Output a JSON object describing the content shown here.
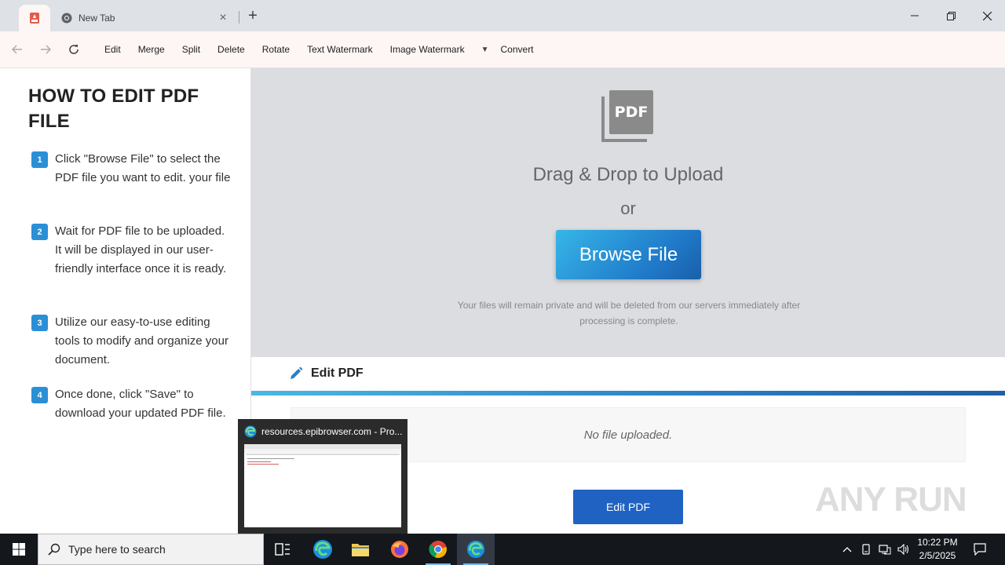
{
  "browser": {
    "active_tab_icon": "pdf-app-icon",
    "tabs": [
      {
        "title": "New Tab",
        "icon": "chrome-icon"
      }
    ],
    "new_tab_symbol": "+",
    "window_controls": {
      "minimize": "—",
      "maximize": "❐",
      "close": "✕"
    }
  },
  "toolbar": {
    "nav": {
      "back": "←",
      "forward": "→",
      "reload": "↻"
    },
    "items": [
      "Edit",
      "Merge",
      "Split",
      "Delete",
      "Rotate",
      "Text Watermark",
      "Image Watermark"
    ],
    "dropdown_caret": "▼",
    "convert_label": "Convert"
  },
  "guide": {
    "title": "HOW TO EDIT PDF FILE",
    "steps": [
      {
        "num": "1",
        "text": "Click \"Browse File\" to select the PDF file you want to edit. your file"
      },
      {
        "num": "2",
        "text": "Wait for PDF file to be uploaded. It will be displayed in our user-friendly interface once it is ready."
      },
      {
        "num": "3",
        "text": "Utilize our easy-to-use editing tools to modify and organize your document."
      },
      {
        "num": "4",
        "text": "Once done, click \"Save\" to download your updated PDF file."
      }
    ]
  },
  "upload": {
    "icon_label": "PDF",
    "drag_text": "Drag & Drop to Upload",
    "or_text": "or",
    "browse_label": "Browse File",
    "privacy_text": "Your files will remain private and will be deleted from our servers immediately after processing is complete."
  },
  "editor": {
    "header_label": "Edit PDF",
    "empty_text": "No file uploaded.",
    "button_label": "Edit PDF"
  },
  "thumbnail": {
    "title": "resources.epibrowser.com - Pro..."
  },
  "watermark": "ANY RUN",
  "taskbar": {
    "search_placeholder": "Type here to search",
    "time": "10:22 PM",
    "date": "2/5/2025"
  }
}
